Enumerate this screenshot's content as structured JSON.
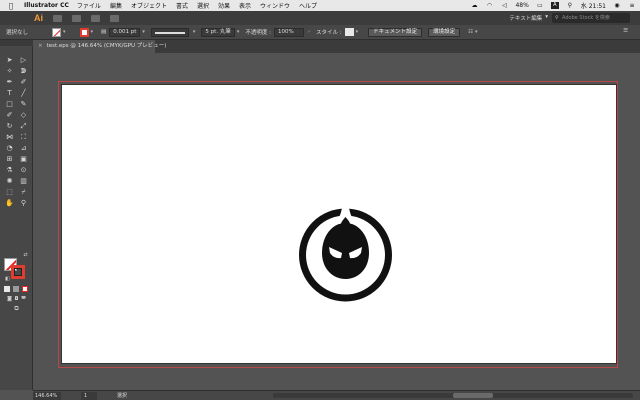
{
  "menubar": {
    "app_name": "Illustrator CC",
    "items": [
      "ファイル",
      "編集",
      "オブジェクト",
      "書式",
      "選択",
      "効果",
      "表示",
      "ウィンドウ",
      "ヘルプ"
    ],
    "battery": "48%",
    "input_mode": "A",
    "clock": "水 21:51"
  },
  "appbar": {
    "logo": "Ai",
    "workspace": "テキスト編集",
    "search_placeholder": "Adobe Stock を検索"
  },
  "controlbar": {
    "selection_label": "選択なし",
    "stroke_weight": "0.001 pt",
    "stroke_profile": "均等",
    "brush": "5 pt. 丸筆",
    "opacity_label": "不透明度 :",
    "opacity_value": "100%",
    "style_label": "スタイル :",
    "document_setup": "ドキュメント設定",
    "preferences": "環境設定"
  },
  "tab": {
    "title": "test.eps @ 146.64% (CMYK/GPU プレビュー)"
  },
  "statusbar": {
    "zoom": "146.64%",
    "page": "1",
    "selection_tool": "選択"
  },
  "colors": {
    "accent": "#e03c2f",
    "ai_logo": "#f29a3a",
    "bleed": "#b84747"
  }
}
